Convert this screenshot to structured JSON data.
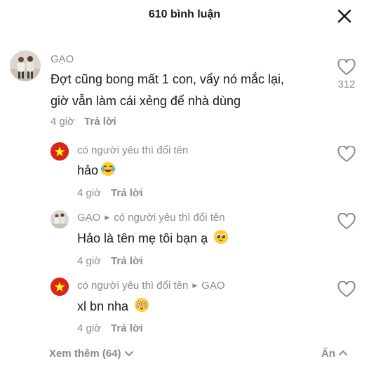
{
  "header": {
    "title": "610 bình luận",
    "close_icon": "close-icon"
  },
  "comments": [
    {
      "username": "GẠO",
      "text": "Đợt cũng bong mất 1 con, vẩy nó mắc lại, giờ vẫn làm cái xẻng để nhà dùng",
      "line1": "Đợt cũng bong mất 1 con, vẩy nó mắc lại,",
      "line2": "giờ vẫn làm cái xẻng để nhà dùng",
      "time": "4 giờ",
      "reply_label": "Trả lời",
      "like_count": "312",
      "avatar": "photo-avatar"
    }
  ],
  "replies": [
    {
      "username": "có người yêu thì đổi tên",
      "text": "hảo",
      "emoji": "tears-of-joy-emoji",
      "time": "4 giờ",
      "reply_label": "Trả lời",
      "avatar": "vietnam-flag-avatar"
    },
    {
      "username": "GẠO",
      "reply_to": "có người yêu thì đổi tên",
      "text": "Hảo là tên mẹ tôi bạn ạ",
      "emoji": "pleading-face-emoji",
      "time": "4 giờ",
      "reply_label": "Trả lời",
      "avatar": "photo-avatar"
    },
    {
      "username": "có người yêu thì đổi tên",
      "reply_to": "GẠO",
      "text": "xl bn nha",
      "emoji": "flushed-face-emoji",
      "time": "4 giờ",
      "reply_label": "Trả lời",
      "avatar": "vietnam-flag-avatar"
    }
  ],
  "footer": {
    "view_more": "Xem thêm (64)",
    "hide": "Ẩn"
  },
  "colors": {
    "text": "#161823",
    "muted": "#8a8b91",
    "flag_red": "#da251d",
    "flag_star": "#ffff00"
  }
}
